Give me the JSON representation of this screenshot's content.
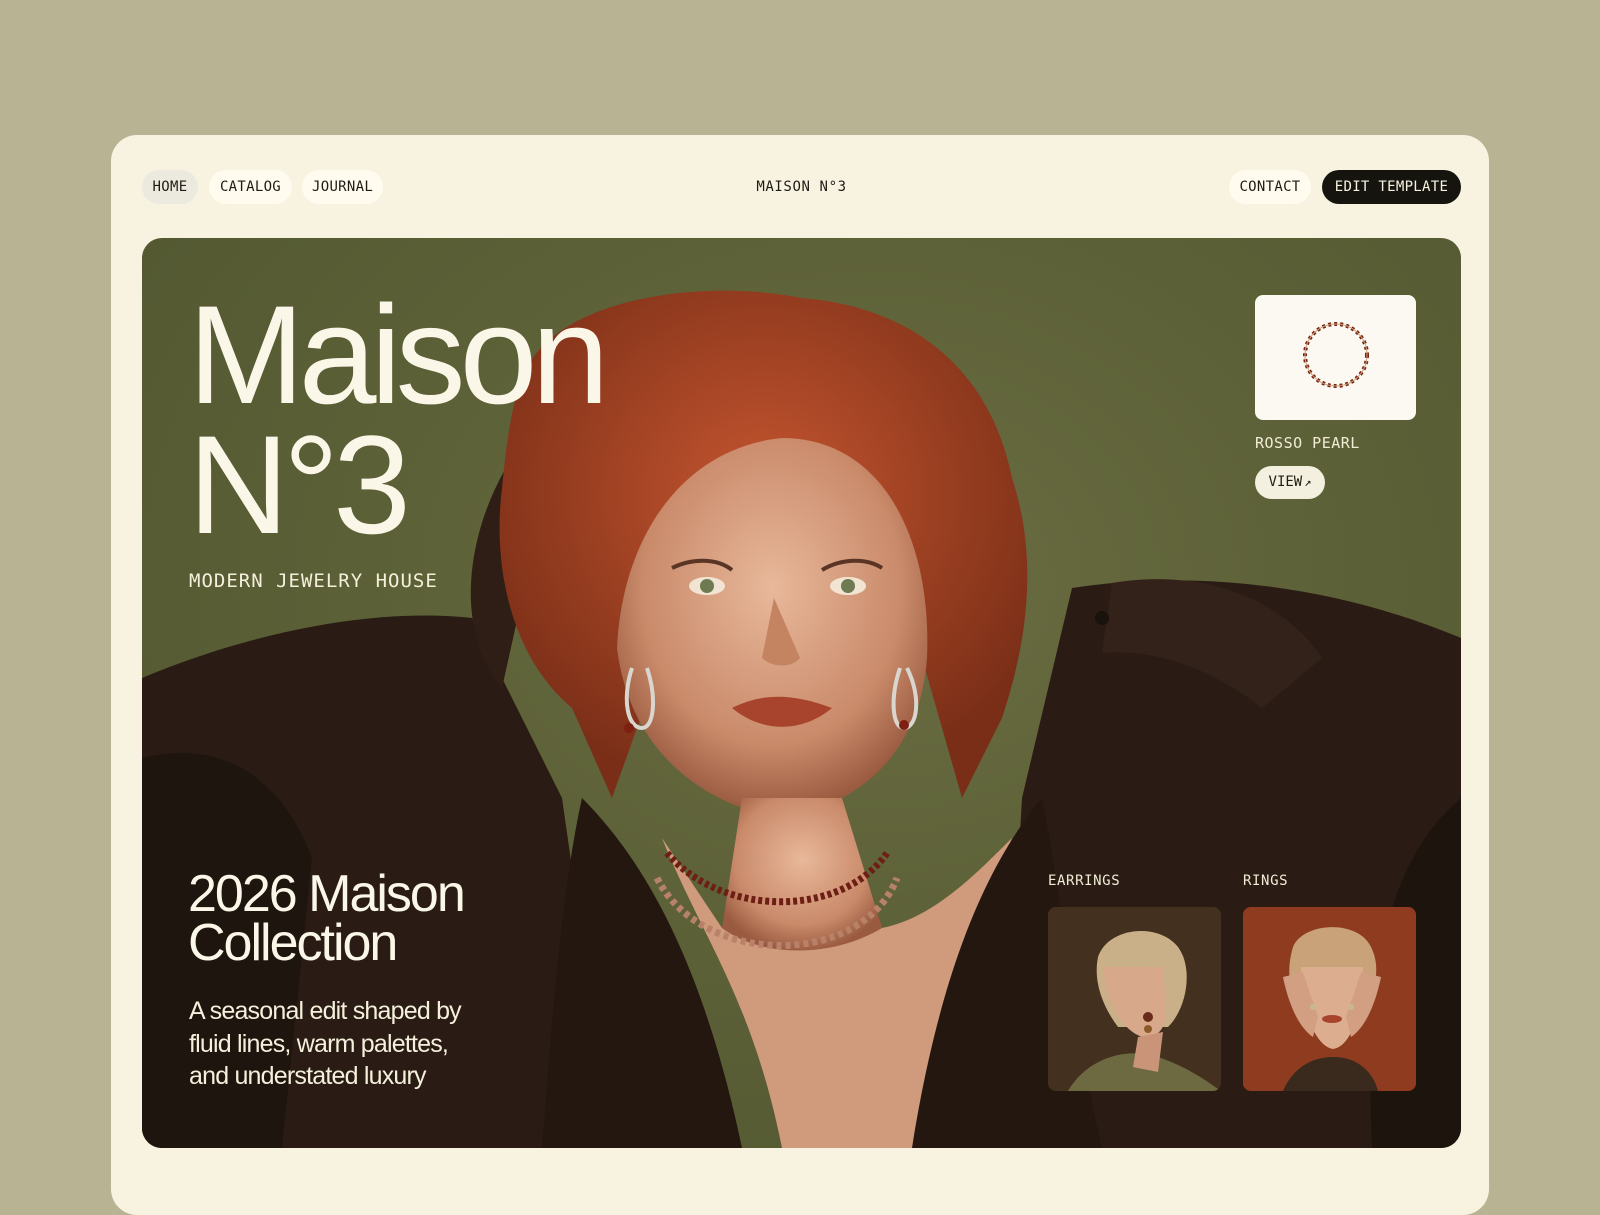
{
  "nav": {
    "home": "HOME",
    "catalog": "CATALOG",
    "journal": "JOURNAL",
    "brand": "MAISON N°3",
    "contact": "CONTACT",
    "edit_template": "EDIT TEMPLATE"
  },
  "hero": {
    "title": "Maison\nN°3",
    "subtitle": "MODERN JEWELRY HOUSE",
    "collection_title": "2026 Maison Collection",
    "collection_description": "A seasonal edit shaped by fluid lines, warm palettes, and understated luxury",
    "featured_product": {
      "name": "ROSSO PEARL",
      "view_label": "VIEW",
      "view_icon": "arrow-up-right-icon"
    },
    "categories": [
      {
        "label": "EARRINGS"
      },
      {
        "label": "RINGS"
      }
    ]
  },
  "colors": {
    "page_background": "#b7b393",
    "card_background": "#f8f3e0",
    "hero_olive": "#5d6137",
    "dark_button": "#16140f",
    "hair_red": "#b5492a"
  }
}
